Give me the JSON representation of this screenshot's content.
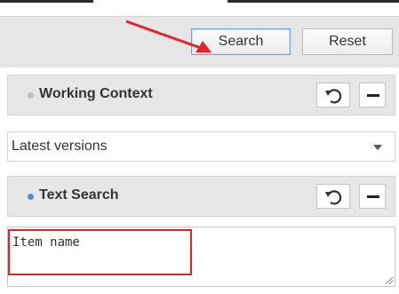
{
  "toolbar": {
    "search_label": "Search",
    "reset_label": "Reset"
  },
  "working_context": {
    "title": "Working Context",
    "select_value": "Latest versions",
    "reset_icon": "reset-icon",
    "minimize_icon": "minimize-icon"
  },
  "text_search": {
    "title": "Text Search",
    "placeholder": "Item name",
    "reset_icon": "reset-icon",
    "minimize_icon": "minimize-icon"
  },
  "colors": {
    "annotation_red": "#e4242b",
    "panel_bg": "#e6e6e6",
    "active_dot": "#4b8fd6",
    "inactive_dot": "#bcbcbc"
  }
}
